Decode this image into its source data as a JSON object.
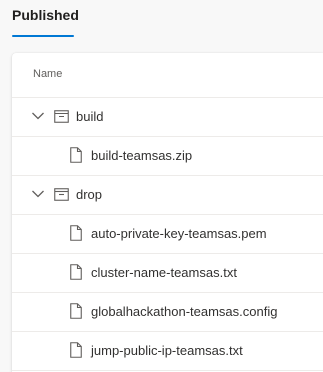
{
  "tabs": [
    {
      "label": "Published",
      "active": true
    }
  ],
  "table": {
    "column_header": "Name",
    "rows": [
      {
        "label": "build",
        "type": "folder",
        "expanded": true,
        "icon": "folder-icon"
      },
      {
        "label": "build-teamsas.zip",
        "type": "file",
        "icon": "file-icon"
      },
      {
        "label": "drop",
        "type": "folder",
        "expanded": true,
        "icon": "folder-icon"
      },
      {
        "label": "auto-private-key-teamsas.pem",
        "type": "file",
        "icon": "file-icon"
      },
      {
        "label": "cluster-name-teamsas.txt",
        "type": "file",
        "icon": "file-icon"
      },
      {
        "label": "globalhackathon-teamsas.config",
        "type": "file",
        "icon": "file-icon"
      },
      {
        "label": "jump-public-ip-teamsas.txt",
        "type": "file",
        "icon": "file-icon"
      }
    ]
  },
  "colors": {
    "accent": "#0078d4",
    "text": "#323130",
    "muted": "#605e5c"
  }
}
